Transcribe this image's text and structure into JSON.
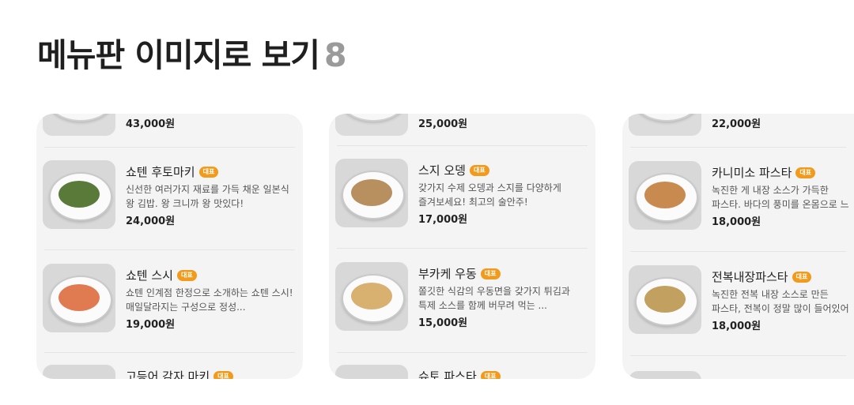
{
  "header": {
    "title": "메뉴판 이미지로 보기",
    "count": "8"
  },
  "badge_label": "대표",
  "colors": {
    "badge": "#f29a1b",
    "card_bg": "#f4f4f4",
    "count": "#9a9a9a"
  },
  "columns": [
    {
      "top_partial": {
        "price": "43,000원"
      },
      "items": [
        {
          "name": "쇼텐 후토마키",
          "desc": "신선한 여러가지 재료를 가득 채운 일본식 왕 김밥. 왕 크니까 왕 맛있다!",
          "price": "24,000원",
          "food_color": "#5a7a3a"
        },
        {
          "name": "쇼텐 스시",
          "desc": "쇼텐 인계점 한정으로 소개하는 쇼텐 스시! 매일달라지는 구성으로 정성...",
          "price": "19,000원",
          "food_color": "#e07a50"
        }
      ],
      "bottom_partial": {
        "name": "고등어 감자 마키"
      }
    },
    {
      "top_partial": {
        "price": "25,000원"
      },
      "items": [
        {
          "name": "스지 오뎅",
          "desc": "갖가지 수제 오뎅과 스지를 다양하게 즐겨보세요! 최고의 술안주!",
          "price": "17,000원",
          "food_color": "#b89060"
        },
        {
          "name": "부카케 우동",
          "desc": "쫄깃한 식감의 우동면을 갖가지 튀김과 특제 소스를 함께 버무려 먹는 ...",
          "price": "15,000원",
          "food_color": "#d8b070"
        }
      ],
      "bottom_partial": {
        "name": "슈토 파스타"
      }
    },
    {
      "top_partial": {
        "price": "22,000원"
      },
      "items": [
        {
          "name": "카니미소 파스타",
          "desc": "녹진한 게 내장 소스가 가득한 파스타. 바다의 풍미를 온몸으로 느",
          "price": "18,000원",
          "food_color": "#c98a50"
        },
        {
          "name": "전복내장파스타",
          "desc": "녹진한 전복 내장 소스로 만든 파스타, 전복이 정말 많이 들어있어",
          "price": "18,000원",
          "food_color": "#c2a060"
        }
      ],
      "bottom_partial": {
        "name": ""
      }
    }
  ]
}
